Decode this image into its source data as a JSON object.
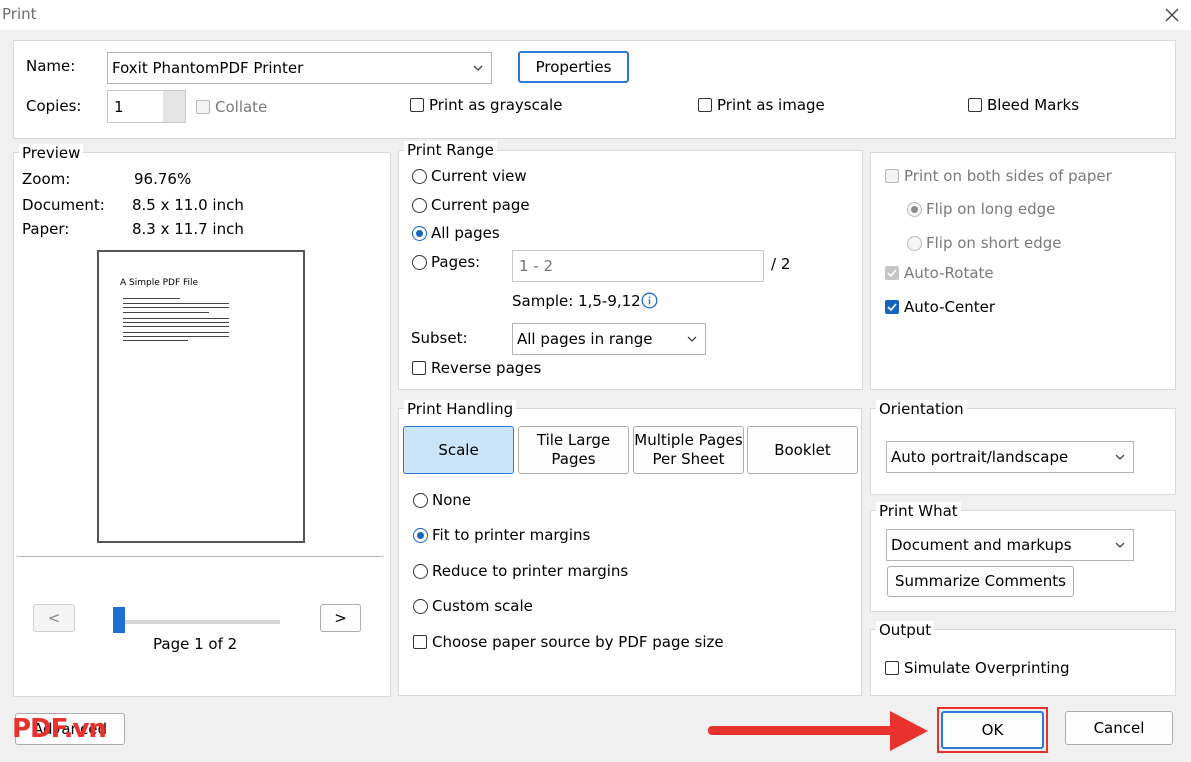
{
  "window": {
    "title": "Print"
  },
  "printer": {
    "name_label": "Name:",
    "name_value": "Foxit PhantomPDF Printer",
    "properties_label": "Properties",
    "copies_label": "Copies:",
    "copies_value": "1",
    "collate_label": "Collate",
    "grayscale_label": "Print as grayscale",
    "image_label": "Print as image",
    "bleed_label": "Bleed Marks"
  },
  "preview": {
    "title": "Preview",
    "zoom_label": "Zoom:",
    "zoom_value": "96.76%",
    "document_label": "Document:",
    "document_value": "8.5 x 11.0 inch",
    "paper_label": "Paper:",
    "paper_value": "8.3 x 11.7 inch",
    "page_title": "A Simple PDF File",
    "prev_label": "<",
    "next_label": ">",
    "page_indicator": "Page 1 of 2",
    "page_position": 1,
    "page_count": 2
  },
  "print_range": {
    "title": "Print Range",
    "current_view": "Current view",
    "current_page": "Current page",
    "all_pages": "All pages",
    "pages_label": "Pages:",
    "pages_placeholder": "1 - 2",
    "pages_total": "/ 2",
    "sample_text": "Sample: 1,5-9,12",
    "subset_label": "Subset:",
    "subset_value": "All pages in range",
    "reverse_label": "Reverse pages"
  },
  "duplex": {
    "both_sides": "Print on both sides of paper",
    "long_edge": "Flip on long edge",
    "short_edge": "Flip on short edge",
    "auto_rotate": "Auto-Rotate",
    "auto_center": "Auto-Center"
  },
  "handling": {
    "title": "Print Handling",
    "tabs": [
      "Scale",
      "Tile Large Pages",
      "Multiple Pages Per Sheet",
      "Booklet"
    ],
    "none": "None",
    "fit": "Fit to printer margins",
    "reduce": "Reduce to printer margins",
    "custom": "Custom scale",
    "paper_source": "Choose paper source by PDF page size"
  },
  "orientation": {
    "title": "Orientation",
    "value": "Auto portrait/landscape"
  },
  "print_what": {
    "title": "Print What",
    "value": "Document and markups",
    "summarize_label": "Summarize Comments"
  },
  "output": {
    "title": "Output",
    "simulate_label": "Simulate Overprinting"
  },
  "footer": {
    "advanced_label": "Advanced",
    "ok_label": "OK",
    "cancel_label": "Cancel",
    "logo": "PDF.vn"
  },
  "colors": {
    "accent": "#1565c0",
    "highlight": "#e8322d",
    "tab_active": "#cce4f7"
  }
}
